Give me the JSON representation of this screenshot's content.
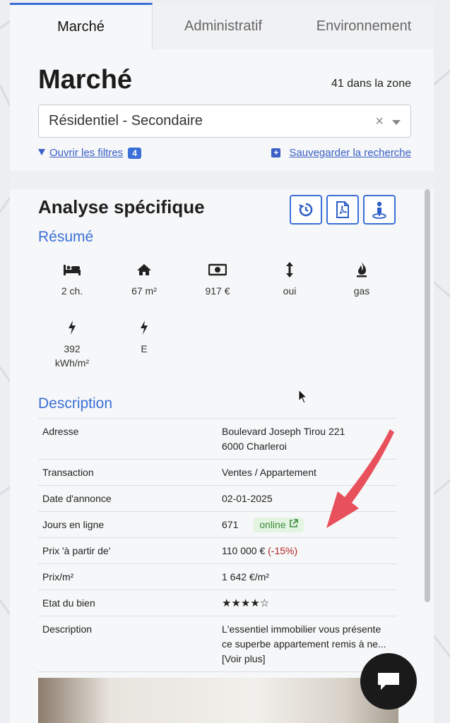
{
  "tabs": [
    {
      "label": "Marché",
      "active": true
    },
    {
      "label": "Administratif",
      "active": false
    },
    {
      "label": "Environnement",
      "active": false
    }
  ],
  "header": {
    "title": "Marché",
    "zone_count": "41 dans la zone"
  },
  "search": {
    "selected_value": "Résidentiel - Secondaire",
    "clear_symbol": "×"
  },
  "filters": {
    "open_filters_label": "Ouvrir les filtres",
    "filter_count": "4",
    "save_search_label": "Sauvegarder la recherche"
  },
  "analysis": {
    "title": "Analyse spécifique",
    "actions": [
      "history-icon",
      "pdf-icon",
      "person-pin-icon"
    ],
    "summary_heading": "Résumé",
    "features": [
      {
        "icon": "bed-icon",
        "value": "2 ch."
      },
      {
        "icon": "home-icon",
        "value": "67 m²"
      },
      {
        "icon": "money-icon",
        "value": "917 €"
      },
      {
        "icon": "vertical-arrows-icon",
        "value": "oui"
      },
      {
        "icon": "fire-icon",
        "value": "gas"
      },
      {
        "icon": "bolt-icon",
        "value": "392\nkWh/m²"
      },
      {
        "icon": "bolt-icon",
        "value": "E"
      }
    ],
    "description_heading": "Description",
    "details": {
      "address_label": "Adresse",
      "address_line1": "Boulevard Joseph Tirou 221",
      "address_line2": "6000 Charleroi",
      "transaction_label": "Transaction",
      "transaction_value": "Ventes / Appartement",
      "date_label": "Date d'annonce",
      "date_value": "02-01-2025",
      "days_label": "Jours en ligne",
      "days_value": "671",
      "online_label": "online",
      "price_label": "Prix 'à partir de'",
      "price_value": "110 000 €",
      "price_change": "(-15%)",
      "price_m2_label": "Prix/m²",
      "price_m2_value": "1 642 €/m²",
      "condition_label": "Etat du bien",
      "condition_stars": 4,
      "condition_max": 5,
      "description_label": "Description",
      "description_value": "L'essentiel immobilier vous présente ce superbe appartement remis à ne...",
      "see_more": "[Voir plus]"
    }
  },
  "colors": {
    "accent": "#3a6fd8",
    "link": "#3a5fc7",
    "online_bg": "#e3f4e3",
    "online_fg": "#3b8c3b",
    "negative": "#b32525",
    "annotation_arrow": "#e8505b"
  }
}
